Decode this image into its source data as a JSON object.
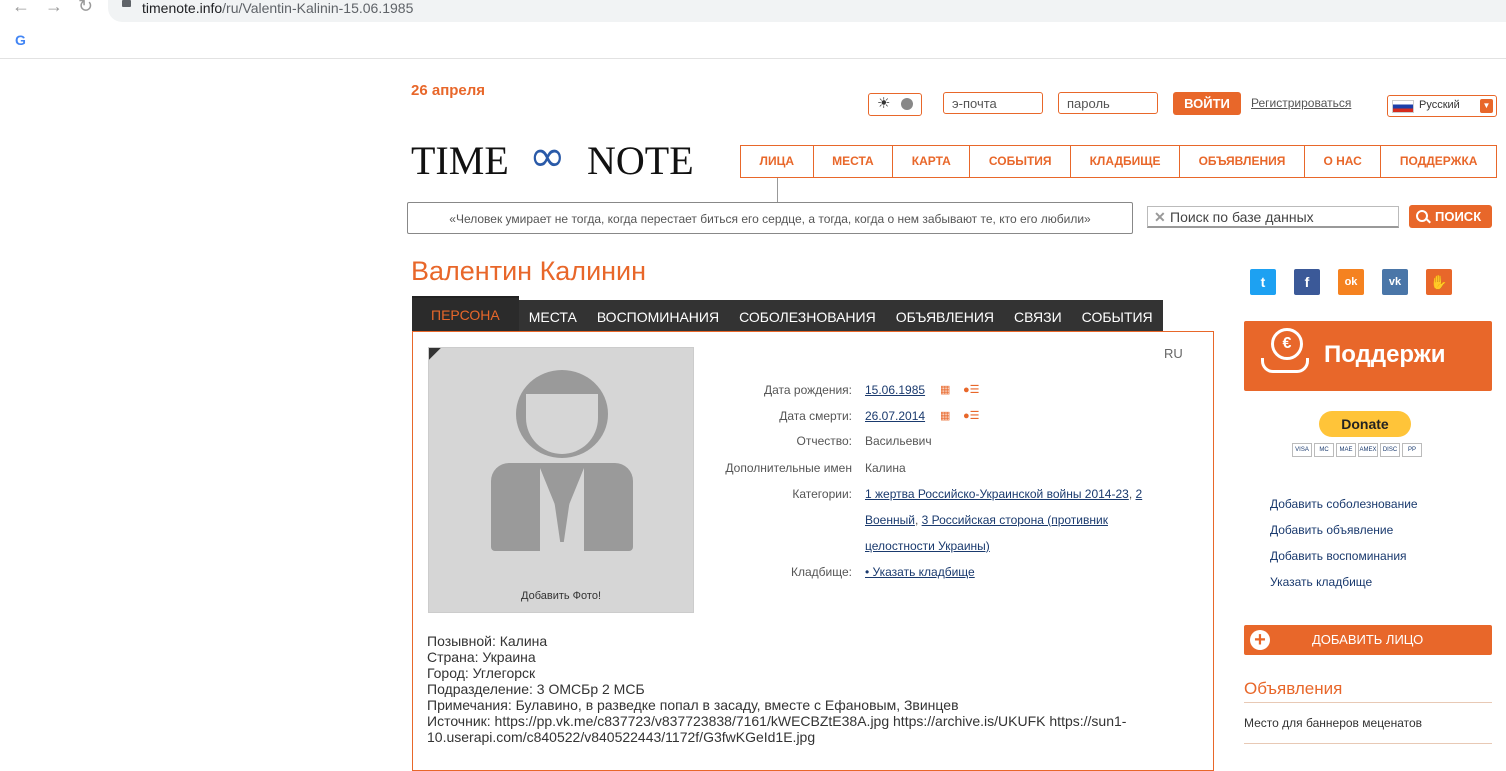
{
  "browser": {
    "url_host": "timenote.info",
    "url_path": "/ru/Valentin-Kalinin-15.06.1985",
    "back_glyph": "←",
    "forward_glyph": "→",
    "reload_glyph": "↻",
    "google_glyph": "G"
  },
  "header": {
    "date": "26 апреля",
    "theme_glyph": "☀",
    "email_placeholder": "э-почта",
    "password_placeholder": "пароль",
    "login_label": "ВОЙТИ",
    "register_label": "Регистрироваться",
    "language": "Русский",
    "dropdown_glyph": "▼"
  },
  "logo": {
    "left": "TIME",
    "symbol": "∞",
    "right": "NOTE"
  },
  "menu": [
    "ЛИЦА",
    "МЕСТА",
    "КАРТА",
    "СОБЫТИЯ",
    "КЛАДБИЩЕ",
    "ОБЪЯВЛЕНИЯ",
    "О НАС",
    "ПОДДЕРЖКА"
  ],
  "quote": "«Человек умирает не тогда, когда перестает биться его сердце, а тогда, когда о нем забывают те, кто его любили»",
  "search": {
    "clear_glyph": "✕",
    "placeholder": "Поиск по базе данных",
    "button": "ПОИСК"
  },
  "person": {
    "name": "Валентин Калинин",
    "tabs": [
      "ПЕРСОНА",
      "МЕСТА",
      "ВОСПОМИНАНИЯ",
      "СОБОЛЕЗНОВАНИЯ",
      "ОБЪЯВЛЕНИЯ",
      "СВЯЗИ",
      "СОБЫТИЯ"
    ],
    "lang_badge": "RU",
    "add_photo": "Добавить Фото!",
    "fields": {
      "birth_label": "Дата рождения:",
      "birth_value": "15.06.1985",
      "death_label": "Дата смерти:",
      "death_value": "26.07.2014",
      "patronymic_label": "Отчество:",
      "patronymic_value": "Васильевич",
      "extra_names_label": "Дополнительные имен",
      "extra_names_value": "Калина",
      "categories_label": "Категории:",
      "category_1": "1 жертва Российско-Украинской войны 2014-23",
      "category_sep": ",",
      "category_2a": "2",
      "category_2b": "Военный",
      "category_3a": "3 Российская сторона (противник",
      "category_3b": "целостности Украины)",
      "cemetery_label": "Кладбище:",
      "cemetery_value": "• Указать кладбище"
    },
    "bio": [
      "Позывной: Калина",
      "Страна: Украина",
      "Город: Углегорск",
      "Подразделение: 3 ОМСБр 2 МСБ",
      "Примечания: Булавино, в разведке попал в засаду, вместе с Ефановым, Звинцев",
      "Источник: https://pp.vk.me/c837723/v837723838/7161/kWECBZtE38A.jpg https://archive.is/UKUFK https://sun1-",
      "10.userapi.com/c840522/v840522443/1172f/G3fwKGeId1E.jpg"
    ]
  },
  "sidebar": {
    "social": [
      {
        "name": "twitter",
        "glyph": "t",
        "color": "#1da1f2"
      },
      {
        "name": "facebook",
        "glyph": "f",
        "color": "#3b5998"
      },
      {
        "name": "odnoklassniki",
        "glyph": "ok",
        "color": "#f58220"
      },
      {
        "name": "vk",
        "glyph": "vk",
        "color": "#4a76a8"
      },
      {
        "name": "other",
        "glyph": "✋",
        "color": "#e8672a"
      }
    ],
    "support_label": "Поддержи",
    "support_coin_glyph": "€",
    "donate_label": "Donate",
    "card_logos": [
      "VISA",
      "MC",
      "MAE",
      "AMEX",
      "DISC",
      "PP"
    ],
    "links": [
      "Добавить соболезнование",
      "Добавить объявление",
      "Добавить воспоминания",
      "Указать кладбище"
    ],
    "add_person_glyph": "+",
    "add_person": "ДОБАВИТЬ ЛИЦО",
    "ads_heading": "Объявления",
    "ads_text": "Место для баннеров меценатов"
  },
  "colors": {
    "accent": "#e8672a",
    "link": "#1a3a6e",
    "dark_tab": "#333333"
  },
  "icons": {
    "calendar": "▦",
    "person_list": "☰"
  }
}
